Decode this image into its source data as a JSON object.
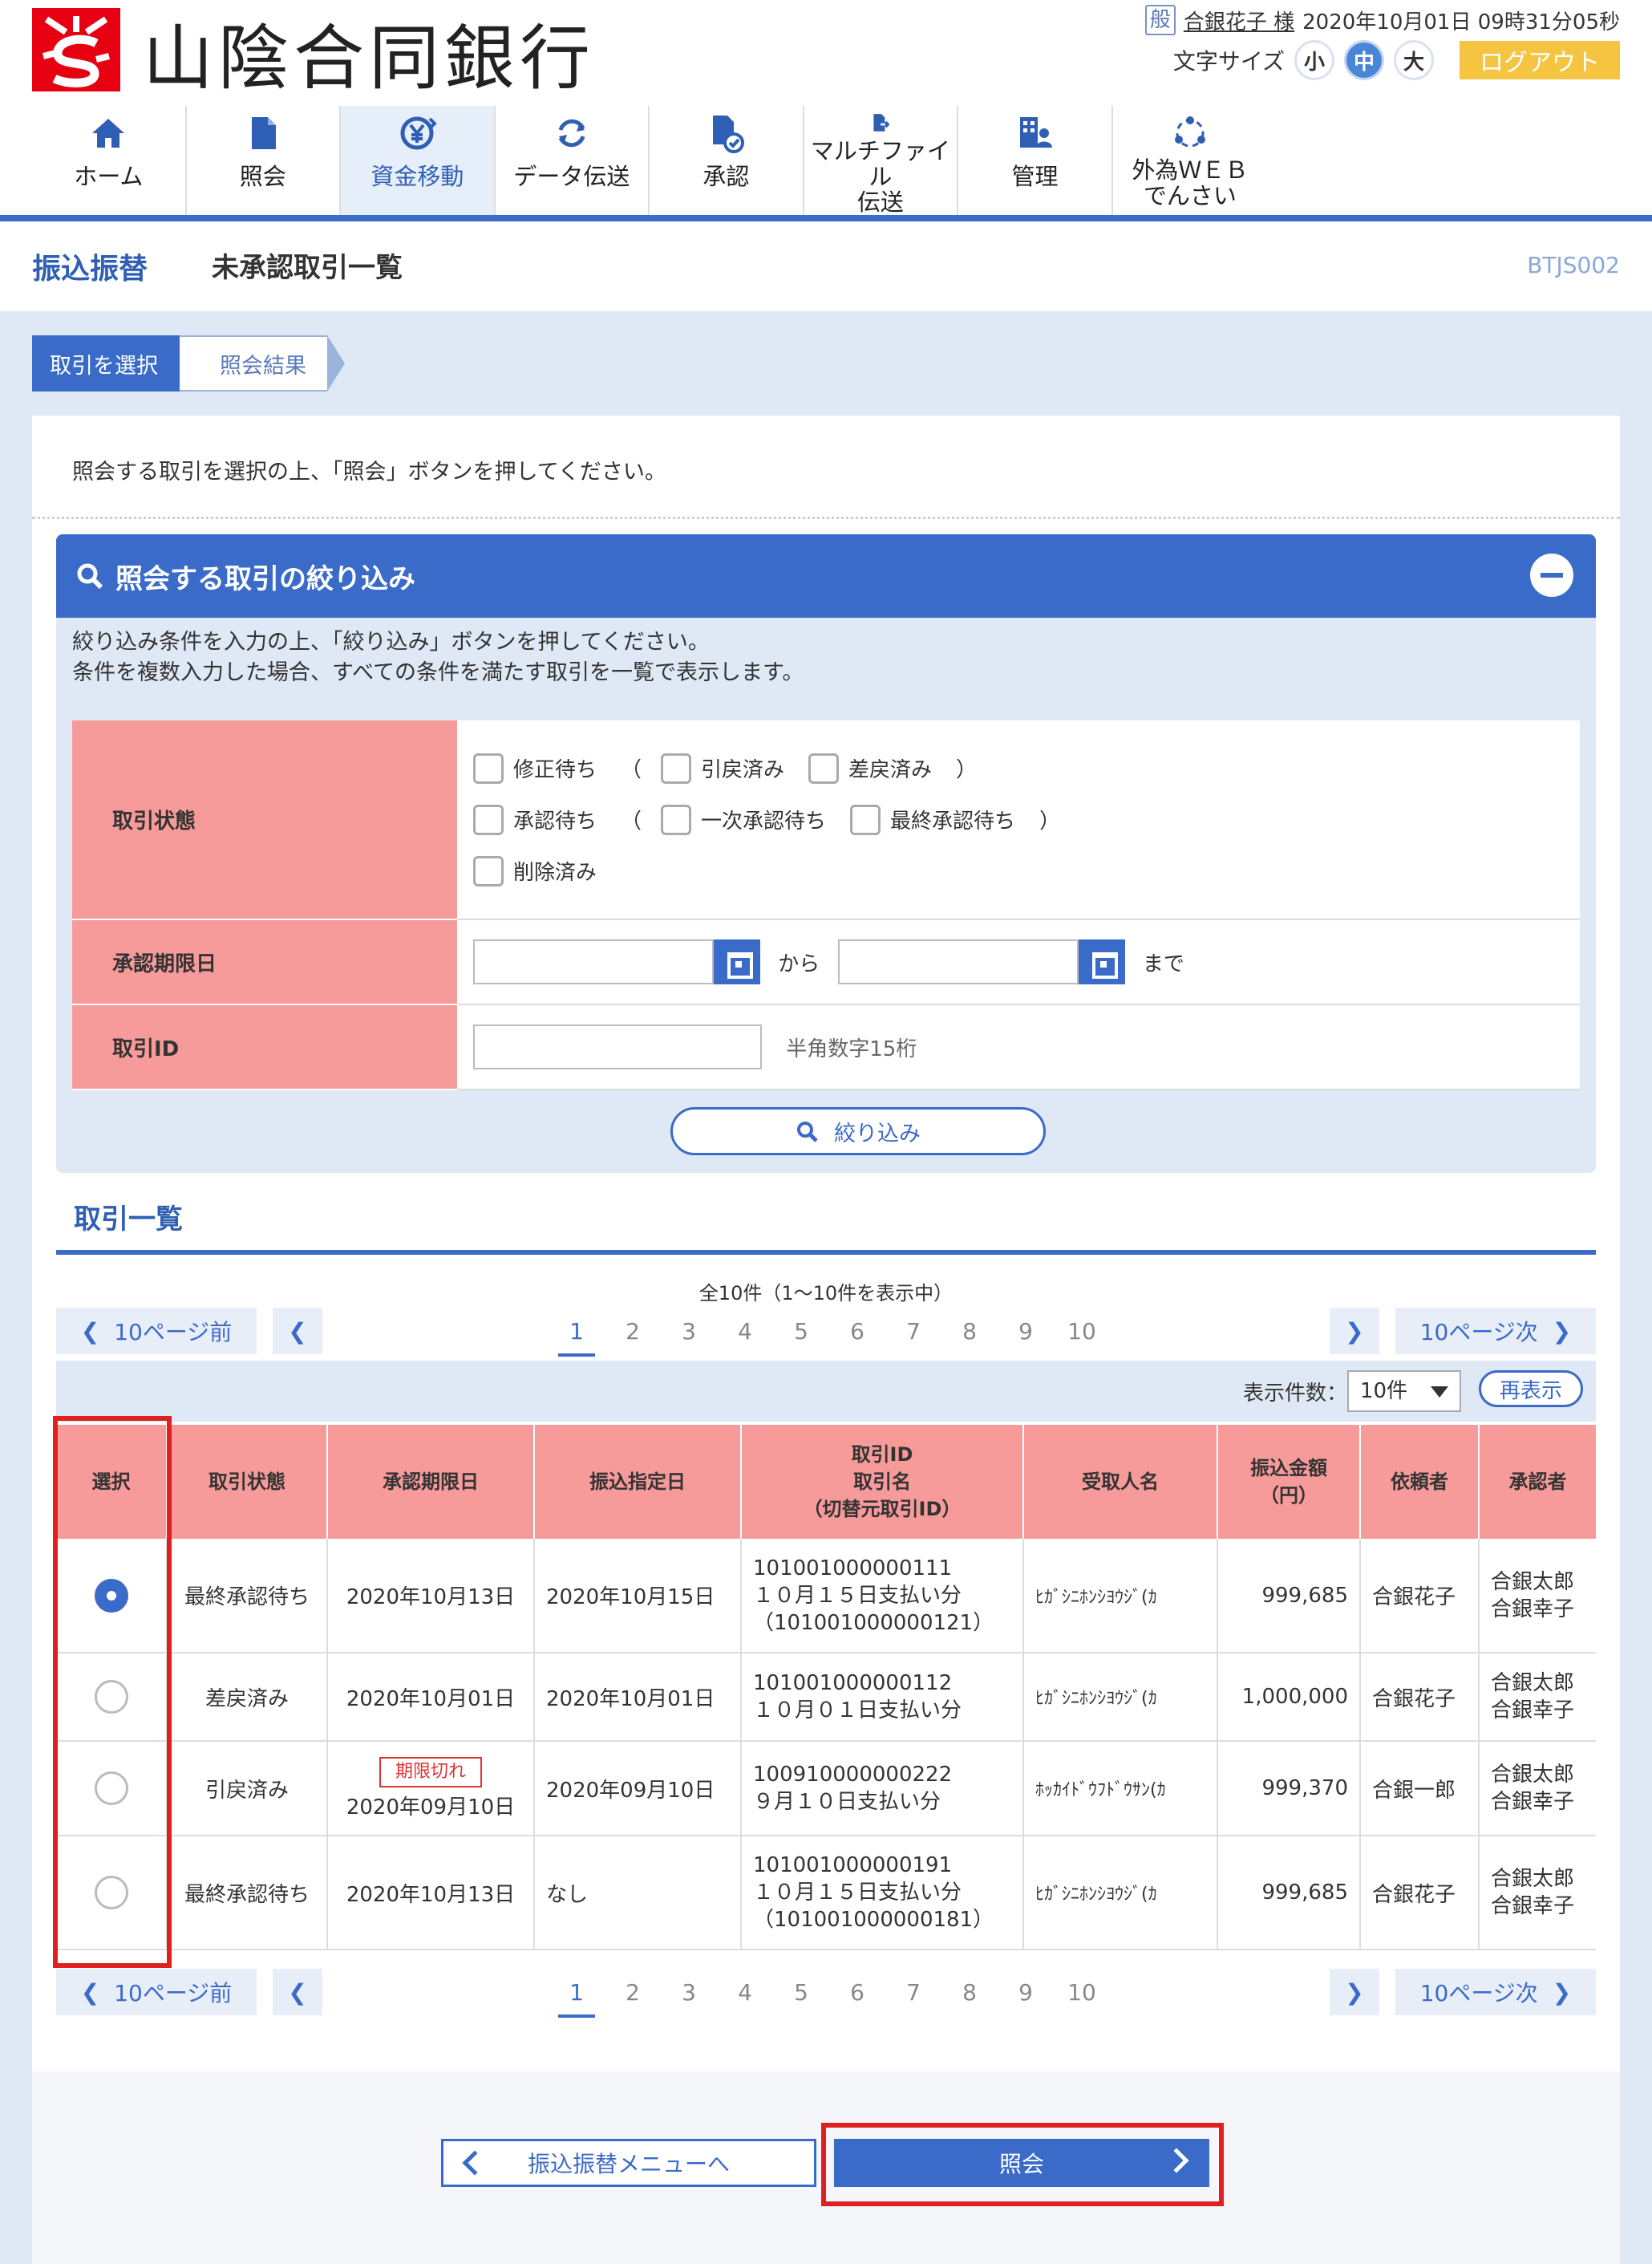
{
  "header": {
    "bank_name": "山陰合同銀行",
    "user_badge": "般",
    "user_name": "合銀花子 様",
    "datetime": "2020年10月01日 09時31分05秒",
    "font_size_label": "文字サイズ",
    "font_sizes": [
      "小",
      "中",
      "大"
    ],
    "logout": "ログアウト"
  },
  "nav": [
    {
      "label": "ホーム",
      "icon": "home-icon"
    },
    {
      "label": "照会",
      "icon": "document-icon"
    },
    {
      "label": "資金移動",
      "icon": "yen-transfer-icon",
      "active": true
    },
    {
      "label": "データ伝送",
      "icon": "refresh-icon"
    },
    {
      "label": "承認",
      "icon": "approve-document-icon"
    },
    {
      "label": "マルチファイル",
      "label2": "伝送",
      "icon": "file-export-icon"
    },
    {
      "label": "管理",
      "icon": "building-user-icon"
    },
    {
      "label": "外為ＷＥＢ",
      "label2": "でんさい",
      "icon": "network-icon"
    }
  ],
  "page": {
    "category": "振込振替",
    "title": "未承認取引一覧",
    "screen_id": "BTJS002"
  },
  "steps": [
    "取引を選択",
    "照会結果"
  ],
  "instruction": "照会する取引を選択の上、「照会」ボタンを押してください。",
  "filter": {
    "title": "照会する取引の絞り込み",
    "desc1": "絞り込み条件を入力の上、「絞り込み」ボタンを押してください。",
    "desc2": "条件を複数入力した場合、すべての条件を満たす取引を一覧で表示します。",
    "status_label": "取引状態",
    "status_options": [
      "修正待ち",
      "引戻済み",
      "差戻済み",
      "承認待ち",
      "一次承認待ち",
      "最終承認待ち",
      "削除済み"
    ],
    "paren_open": "（",
    "paren_close": "）",
    "deadline_label": "承認期限日",
    "from": "から",
    "to": "まで",
    "id_label": "取引ID",
    "id_hint": "半角数字15桁",
    "button": "絞り込み"
  },
  "list": {
    "title": "取引一覧",
    "total": "全10件（1～10件を表示中）",
    "prev10": "10ページ前",
    "next10": "10ページ次",
    "pages": [
      "1",
      "2",
      "3",
      "4",
      "5",
      "6",
      "7",
      "8",
      "9",
      "10"
    ],
    "current_page": "1",
    "display_count_label": "表示件数：",
    "display_count": "10件",
    "redisplay": "再表示",
    "headers": {
      "select": "選択",
      "status": "取引状態",
      "deadline": "承認期限日",
      "transfer_date": "振込指定日",
      "id1": "取引ID",
      "id2": "取引名",
      "id3": "（切替元取引ID）",
      "payee": "受取人名",
      "amount1": "振込金額",
      "amount2": "（円）",
      "requester": "依頼者",
      "approver": "承認者"
    },
    "rows": [
      {
        "selected": true,
        "status": "最終承認待ち",
        "expired": "",
        "deadline": "2020年10月13日",
        "transfer_date": "2020年10月15日",
        "id": "101001000000111",
        "name": "１０月１５日支払い分",
        "orig_id": "（101001000000121）",
        "payee": "ﾋｶﾞｼﾆﾎﾝｼﾖｳｼﾞ(ｶ",
        "amount": "999,685",
        "requester": "合銀花子",
        "approver1": "合銀太郎",
        "approver2": "合銀幸子"
      },
      {
        "selected": false,
        "status": "差戻済み",
        "expired": "",
        "deadline": "2020年10月01日",
        "transfer_date": "2020年10月01日",
        "id": "101001000000112",
        "name": "１０月０１日支払い分",
        "orig_id": "",
        "payee": "ﾋｶﾞｼﾆﾎﾝｼﾖｳｼﾞ(ｶ",
        "amount": "1,000,000",
        "requester": "合銀花子",
        "approver1": "合銀太郎",
        "approver2": "合銀幸子"
      },
      {
        "selected": false,
        "status": "引戻済み",
        "expired": "期限切れ",
        "deadline": "2020年09月10日",
        "transfer_date": "2020年09月10日",
        "id": "100910000000222",
        "name": "９月１０日支払い分",
        "orig_id": "",
        "payee": "ﾎｯｶｲﾄﾞｳﾌﾄﾞｳｻﾝ(ｶ",
        "amount": "999,370",
        "requester": "合銀一郎",
        "approver1": "合銀太郎",
        "approver2": "合銀幸子"
      },
      {
        "selected": false,
        "status": "最終承認待ち",
        "expired": "",
        "deadline": "2020年10月13日",
        "transfer_date": "なし",
        "id": "101001000000191",
        "name": "１０月１５日支払い分",
        "orig_id": "（101001000000181）",
        "payee": "ﾋｶﾞｼﾆﾎﾝｼﾖｳｼﾞ(ｶ",
        "amount": "999,685",
        "requester": "合銀花子",
        "approver1": "合銀太郎",
        "approver2": "合銀幸子"
      }
    ]
  },
  "footer": {
    "back": "振込振替メニューへ",
    "submit": "照会"
  },
  "colors": {
    "primary": "#3b6bc8",
    "header_pink": "#f79a9a",
    "highlight_red": "#e02020",
    "logout_yellow": "#f5c542"
  }
}
